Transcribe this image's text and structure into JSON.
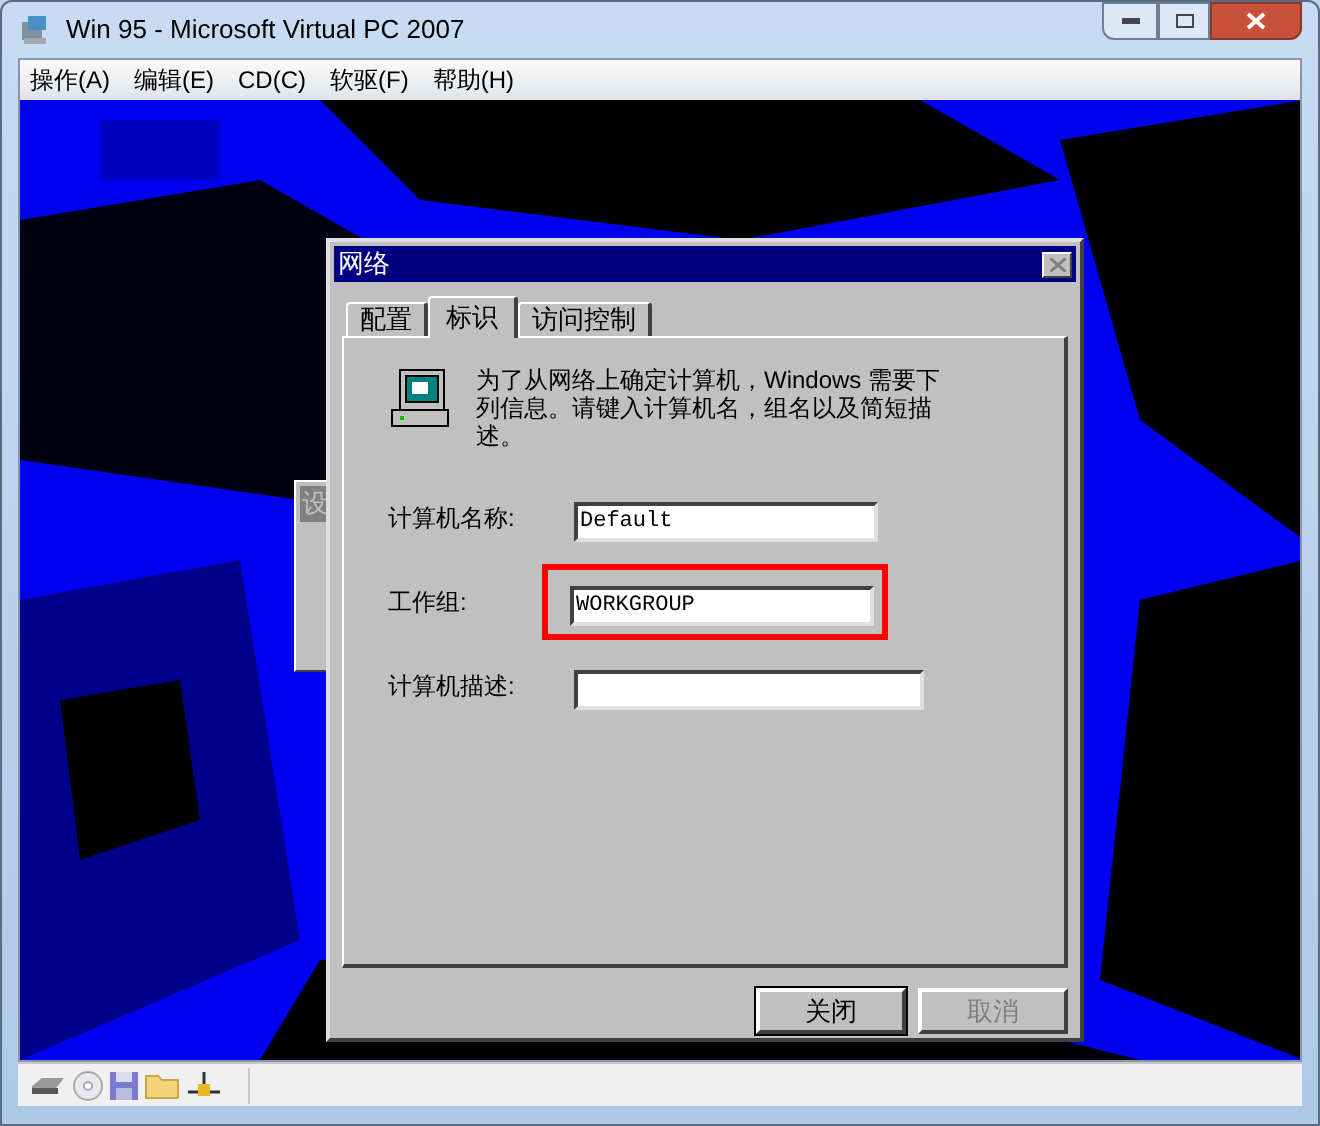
{
  "window": {
    "title": "Win 95 - Microsoft Virtual PC 2007"
  },
  "menu": [
    "操作(A)",
    "编辑(E)",
    "CD(C)",
    "软驱(F)",
    "帮助(H)"
  ],
  "background_window": {
    "title": "设"
  },
  "dialog": {
    "title": "网络",
    "tabs": [
      {
        "label": "配置",
        "selected": false
      },
      {
        "label": "标识",
        "selected": true
      },
      {
        "label": "访问控制",
        "selected": false
      }
    ],
    "info": "为了从网络上确定计算机，Windows 需要下列信息。请键入计算机名，组名以及简短描述。",
    "fields": [
      {
        "label": "计算机名称:",
        "value": "Default",
        "highlighted": false
      },
      {
        "label": "工作组:",
        "value": "WORKGROUP",
        "highlighted": true
      },
      {
        "label": "计算机描述:",
        "highlighted": false
      }
    ],
    "buttons": [
      {
        "label": "关闭",
        "default": true,
        "disabled": false
      },
      {
        "label": "取消",
        "default": false,
        "disabled": true
      }
    ]
  }
}
